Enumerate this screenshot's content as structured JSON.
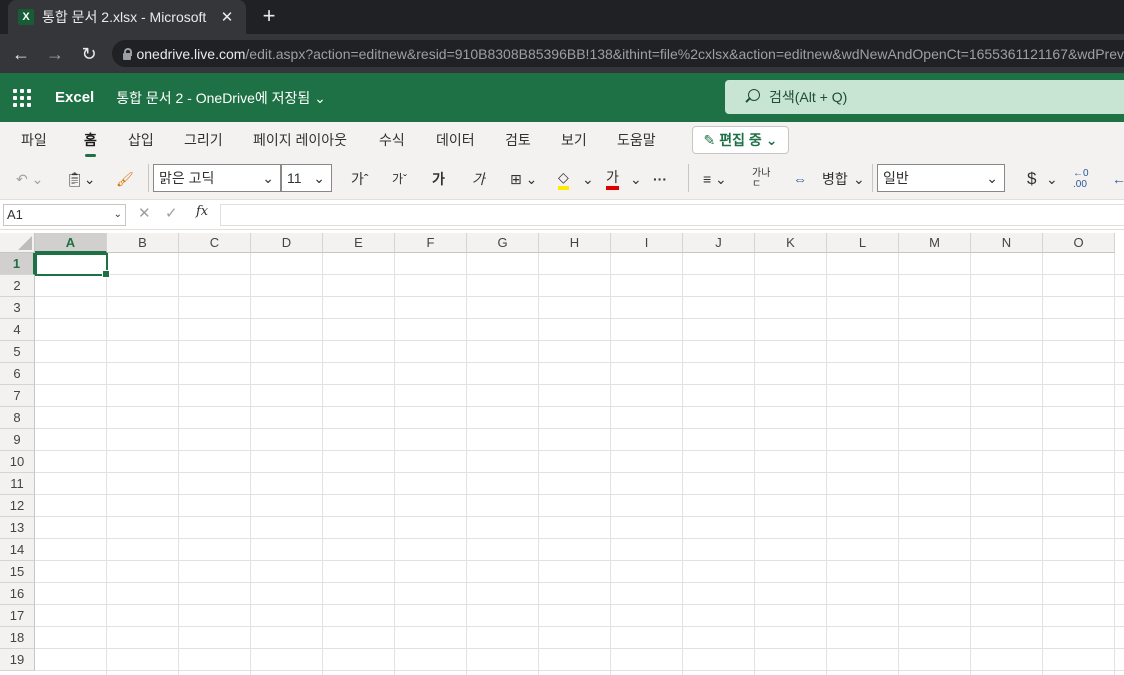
{
  "browser": {
    "tab_title": "통합 문서 2.xlsx - Microsoft",
    "favicon_letter": "X",
    "tab_close": "✕",
    "new_tab": "+",
    "url_host": "onedrive.live.com",
    "url_path": "/edit.aspx?action=editnew&resid=910B8308B85396BB!138&ithint=file%2cxlsx&action=editnew&wdNewAndOpenCt=1655361121167&wdPrev"
  },
  "appbar": {
    "app_name": "Excel",
    "doc_title": "통합 문서 2  -  OneDrive에 저장됨 ⌄",
    "search_placeholder": "검색(Alt + Q)",
    "brand_color": "#1e7145"
  },
  "ribbon": {
    "tabs": [
      "파일",
      "홈",
      "삽입",
      "그리기",
      "페이지 레이아웃",
      "수식",
      "데이터",
      "검토",
      "보기",
      "도움말"
    ],
    "active_tab": "홈",
    "edit_mode": "편집 중 ⌄"
  },
  "toolbar": {
    "font_name": "맑은 고딕",
    "font_size": "11",
    "grow_font": "가ˆ",
    "shrink_font": "가ˇ",
    "bold": "가",
    "italic": "가",
    "font_color_glyph": "가",
    "more": "···",
    "wrap": "가나\nㄷ",
    "merge": "병합",
    "number_format": "일반",
    "currency": "$",
    "decimal": "←0\n.00"
  },
  "formula_bar": {
    "name_box": "A1",
    "fx": "fx"
  },
  "sheet": {
    "columns": [
      "A",
      "B",
      "C",
      "D",
      "E",
      "F",
      "G",
      "H",
      "I",
      "J",
      "K",
      "L",
      "M",
      "N",
      "O"
    ],
    "rows": [
      "1",
      "2",
      "3",
      "4",
      "5",
      "6",
      "7",
      "8",
      "9",
      "10",
      "11",
      "12",
      "13",
      "14",
      "15",
      "16",
      "17",
      "18",
      "19"
    ],
    "active_cell": "A1"
  }
}
